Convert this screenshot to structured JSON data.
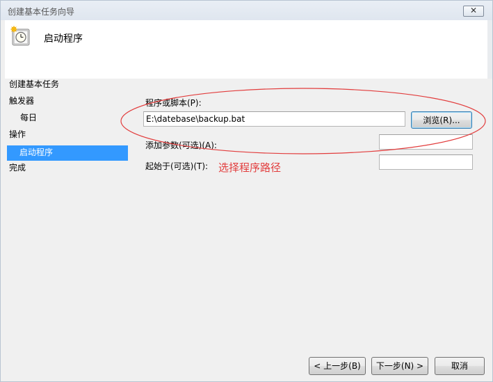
{
  "window": {
    "title": "创建基本任务向导",
    "close_symbol": "✕"
  },
  "header": {
    "title": "启动程序",
    "icon": "clock-task-icon"
  },
  "sidebar": {
    "items": [
      {
        "label": "创建基本任务",
        "selected": false
      },
      {
        "label": "触发器",
        "selected": false
      },
      {
        "label": "每日",
        "selected": false
      },
      {
        "label": "操作",
        "selected": false
      },
      {
        "label": "启动程序",
        "selected": true
      },
      {
        "label": "完成",
        "selected": false
      }
    ]
  },
  "form": {
    "program_label": "程序或脚本(P):",
    "program_value": "E:\\datebase\\backup.bat",
    "browse_label": "浏览(R)...",
    "args_label": "添加参数(可选)(A):",
    "args_value": "",
    "start_in_label": "起始于(可选)(T):",
    "start_in_value": ""
  },
  "annotation": {
    "text": "选择程序路径",
    "color": "#e23c3c"
  },
  "footer": {
    "back_label": "< 上一步(B)",
    "next_label": "下一步(N) >",
    "cancel_label": "取消"
  },
  "colors": {
    "selection": "#3399ff",
    "annotation": "#e23c3c"
  }
}
